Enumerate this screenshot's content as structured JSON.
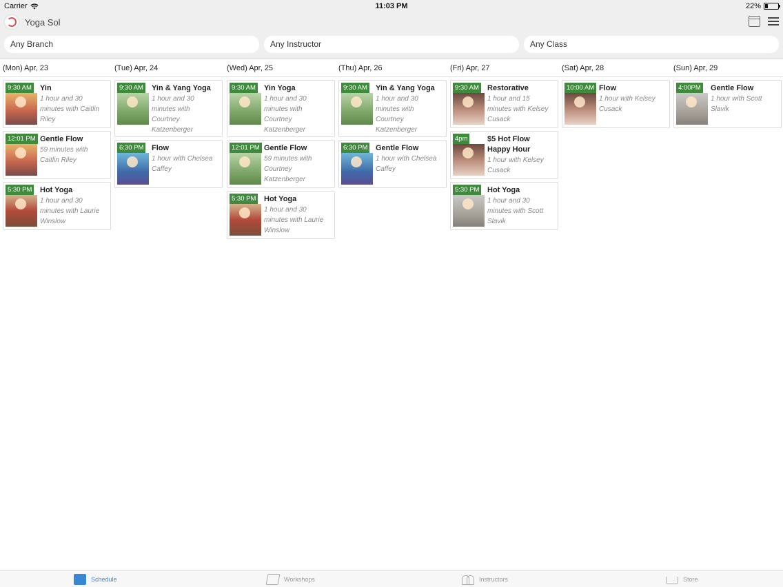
{
  "status_bar": {
    "carrier": "Carrier",
    "time": "11:03 PM",
    "battery_text": "22%",
    "battery_level": 0.22
  },
  "app": {
    "title": "Yoga Sol"
  },
  "filters": {
    "branch": "Any Branch",
    "instructor": "Any Instructor",
    "class": "Any Class"
  },
  "days": [
    {
      "label": "(Mon) Apr, 23",
      "classes": [
        {
          "time": "9:30 AM",
          "title": "Yin",
          "desc_lines": [
            "1 hour and 30",
            "minutes with Caitlin",
            "Riley"
          ],
          "thumb": "sunset"
        },
        {
          "time": "12:01 PM",
          "title": "Gentle Flow",
          "desc_lines": [
            "59 minutes with",
            "Caitlin Riley"
          ],
          "thumb": "sunset"
        },
        {
          "time": "5:30 PM",
          "title": "Hot Yoga",
          "desc_lines": [
            "1 hour and 30",
            "minutes with Laurie",
            "Winslow"
          ],
          "thumb": "forest"
        }
      ]
    },
    {
      "label": "(Tue) Apr, 24",
      "classes": [
        {
          "time": "9:30 AM",
          "title": "Yin & Yang Yoga",
          "desc_lines": [
            "1 hour and 30",
            "minutes with",
            "Courtney",
            "Katzenberger"
          ],
          "thumb": "meadow"
        },
        {
          "time": "6:30 PM",
          "title": "Flow",
          "desc_lines": [
            "1 hour with Chelsea",
            "Caffey"
          ],
          "thumb": "blue"
        }
      ]
    },
    {
      "label": "(Wed) Apr, 25",
      "classes": [
        {
          "time": "9:30 AM",
          "title": "Yin Yoga",
          "desc_lines": [
            "1 hour and 30",
            "minutes with",
            "Courtney",
            "Katzenberger"
          ],
          "thumb": "meadow"
        },
        {
          "time": "12:01 PM",
          "title": "Gentle Flow",
          "desc_lines": [
            "59 minutes with",
            "Courtney",
            "Katzenberger"
          ],
          "thumb": "meadow"
        },
        {
          "time": "5:30 PM",
          "title": "Hot Yoga",
          "desc_lines": [
            "1 hour and 30",
            "minutes with Laurie",
            "Winslow"
          ],
          "thumb": "forest"
        }
      ]
    },
    {
      "label": "(Thu) Apr, 26",
      "classes": [
        {
          "time": "9:30 AM",
          "title": "Yin & Yang Yoga",
          "desc_lines": [
            "1 hour and 30",
            "minutes with",
            "Courtney",
            "Katzenberger"
          ],
          "thumb": "meadow"
        },
        {
          "time": "6:30 PM",
          "title": "Gentle Flow",
          "desc_lines": [
            "1 hour with Chelsea",
            "Caffey"
          ],
          "thumb": "blue"
        }
      ]
    },
    {
      "label": "(Fri) Apr, 27",
      "classes": [
        {
          "time": "9:30 AM",
          "title": "Restorative",
          "desc_lines": [
            "1 hour and 15",
            "minutes with Kelsey",
            "Cusack"
          ],
          "thumb": "portrait"
        },
        {
          "time": "4pm",
          "title": "$5 Hot Flow Happy Hour",
          "title_lines": 2,
          "desc_lines": [
            "1 hour with Kelsey",
            "Cusack"
          ],
          "thumb": "portrait"
        },
        {
          "time": "5:30 PM",
          "title": "Hot Yoga",
          "desc_lines": [
            "1 hour and 30",
            "minutes with Scott",
            "Slavik"
          ],
          "thumb": "grey"
        }
      ]
    },
    {
      "label": "(Sat) Apr, 28",
      "classes": [
        {
          "time": "10:00 AM",
          "title": "Flow",
          "desc_lines": [
            "1 hour with Kelsey",
            "Cusack"
          ],
          "thumb": "portrait"
        }
      ]
    },
    {
      "label": "(Sun) Apr, 29",
      "classes": [
        {
          "time": "4:00PM",
          "title": "Gentle Flow",
          "desc_lines": [
            "1 hour with Scott",
            "Slavik"
          ],
          "thumb": "grey"
        }
      ]
    }
  ],
  "tabbar": {
    "items": [
      {
        "label": "Schedule",
        "icon": "calendar-icon",
        "active": true
      },
      {
        "label": "Workshops",
        "icon": "box-icon",
        "active": false
      },
      {
        "label": "Instructors",
        "icon": "people-icon",
        "active": false
      },
      {
        "label": "Store",
        "icon": "cart-icon",
        "active": false
      }
    ],
    "active_color": "#3a86d6"
  },
  "colors": {
    "time_badge": "#3f8a3c",
    "chrome_bg": "#efeff0"
  }
}
